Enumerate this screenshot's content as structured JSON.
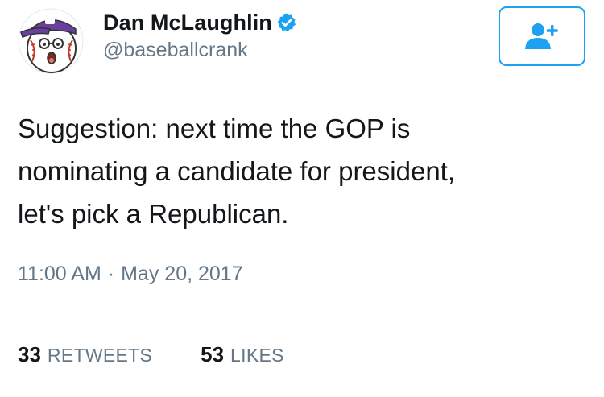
{
  "tweet": {
    "author": {
      "display_name": "Dan McLaughlin",
      "handle": "@baseballcrank",
      "verified": true,
      "avatar_icon": "baseball-cartoon-avatar"
    },
    "follow_button_icon": "add-user-icon",
    "text": "Suggestion: next time the GOP is\nnominating a candidate for president,\nlet's pick a Republican.",
    "time": "11:00 AM",
    "separator": "·",
    "date": "May 20, 2017",
    "stats": {
      "retweets_count": "33",
      "retweets_label": "RETWEETS",
      "likes_count": "53",
      "likes_label": "LIKES"
    }
  },
  "colors": {
    "accent": "#1da1f2",
    "text_primary": "#14171a",
    "text_secondary": "#657786",
    "divider": "#ccd6dd"
  }
}
